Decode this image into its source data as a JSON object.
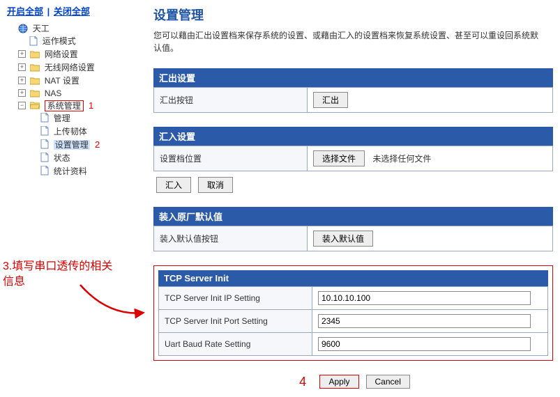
{
  "top_links": {
    "open_all": "开启全部",
    "close_all": "关闭全部"
  },
  "tree": {
    "root": "天工",
    "op_mode": "运作模式",
    "net_settings": "网络设置",
    "wireless": "无线网络设置",
    "nat": "NAT 设置",
    "nas": "NAS",
    "sys_mgmt": "系统管理",
    "mgmt": "管理",
    "upload_fw": "上传韧体",
    "settings_mgmt": "设置管理",
    "status": "状态",
    "stats": "统计资料"
  },
  "annotations": {
    "n1": "1",
    "n2": "2",
    "n4": "4",
    "note3": "3.填写串口透传的相关信息"
  },
  "page": {
    "title": "设置管理",
    "desc": "您可以藉由汇出设置档来保存系统的设置、或藉由汇入的设置档来恢复系统设置、甚至可以重设回系统默认值。"
  },
  "export": {
    "head": "汇出设置",
    "label": "汇出按钮",
    "btn": "汇出"
  },
  "import": {
    "head": "汇入设置",
    "label": "设置档位置",
    "choose_btn": "选择文件",
    "no_file": "未选择任何文件",
    "import_btn": "汇入",
    "cancel_btn": "取消"
  },
  "factory": {
    "head": "装入原厂默认值",
    "label": "装入默认值按钮",
    "btn": "装入默认值"
  },
  "tcp": {
    "head": "TCP Server Init",
    "ip_label": "TCP Server Init IP Setting",
    "ip_value": "10.10.10.100",
    "port_label": "TCP Server Init Port Setting",
    "port_value": "2345",
    "baud_label": "Uart Baud Rate Setting",
    "baud_value": "9600"
  },
  "footer": {
    "apply": "Apply",
    "cancel": "Cancel"
  }
}
